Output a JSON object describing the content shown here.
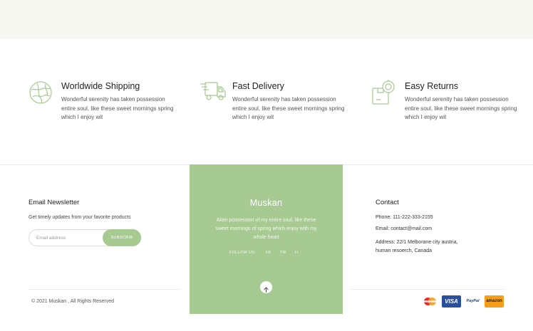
{
  "features": [
    {
      "icon": "globe-icon",
      "title": "Worldwide Shipping",
      "desc": "Wonderful serenity has taken possession entire soul, like these sweet mornings spring which I enjoy wit"
    },
    {
      "icon": "delivery-truck-icon",
      "title": "Fast Delivery",
      "desc": "Wonderful serenity has taken possession entire soul, like these sweet mornings spring which I enjoy wit"
    },
    {
      "icon": "return-box-icon",
      "title": "Easy Returns",
      "desc": "Wonderful serenity has taken possession entire soul, like these sweet mornings spring which I enjoy wit"
    }
  ],
  "newsletter": {
    "title": "Email Newsletter",
    "text": "Get timely updates from your favorite products",
    "placeholder": "Email address",
    "button": "SUBSCRIB"
  },
  "brand": {
    "name": "Muskan",
    "desc": "Aken possession of my entire soul, like these sweet mornings of spring which enjoy with my whole heart",
    "follow_label": "FOLLOW US:",
    "social": [
      "FB",
      "TW",
      "LI"
    ]
  },
  "contact": {
    "title": "Contact",
    "phone": "Phone: 111-222-333-2155",
    "email": "Email: contact@mail.com",
    "address_line1": "Address: 22/1 Melborane city austria,",
    "address_line2": "human resoerch, Canada"
  },
  "footer": {
    "copyright": "© 2021 Muskan , All Rights Reserved",
    "payments": [
      "mastercard-icon",
      "visa-icon",
      "paypal-icon",
      "amazon-icon"
    ],
    "visa_label": "VISA",
    "paypal_label": "PayPal",
    "amazon_label": "amazon"
  },
  "colors": {
    "accent_green": "#a7c992",
    "top_band": "#f7f8f2",
    "visa_blue": "#2a4f9c",
    "amazon_orange": "#f59e1b"
  }
}
